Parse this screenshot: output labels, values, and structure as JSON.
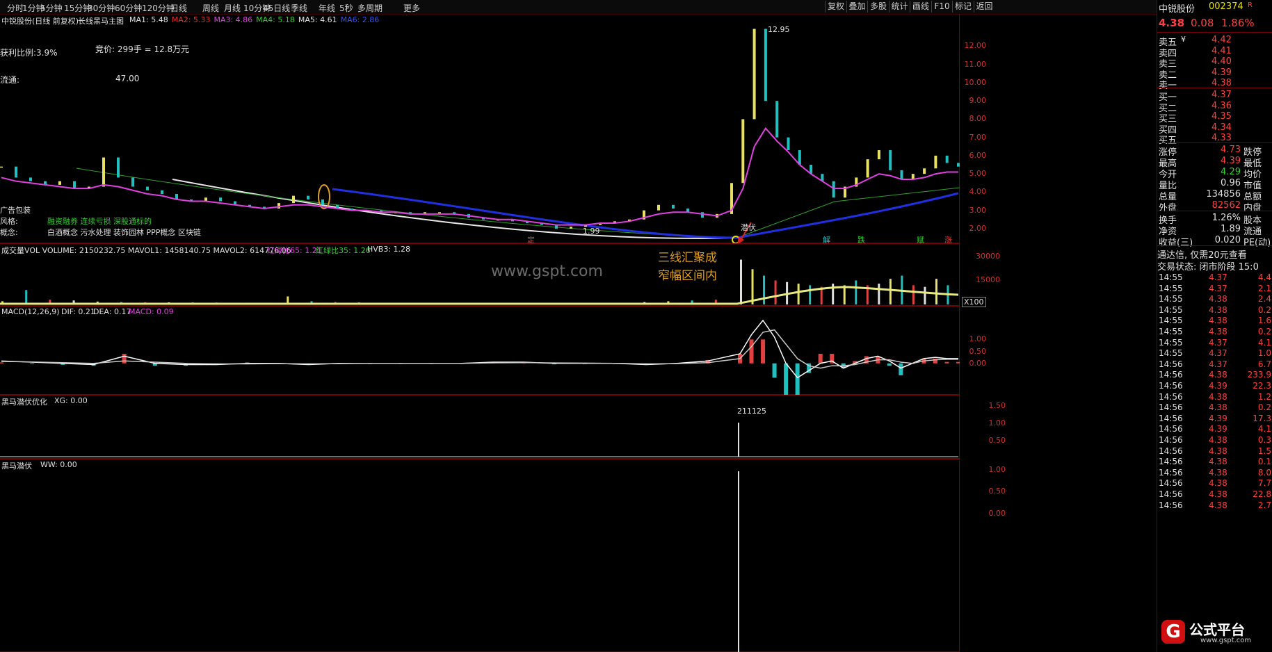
{
  "toolbar": {
    "timeframes": [
      "分时",
      "1分钟",
      "5分钟",
      "15分钟",
      "30分钟",
      "60分钟",
      "120分钟",
      "日线",
      "周线",
      "月线",
      "10分钟",
      "45日线",
      "季线",
      "年线",
      "5秒",
      "多周期",
      "更多"
    ],
    "buttons": [
      "复权",
      "叠加",
      "多股",
      "统计",
      "画线",
      "F10",
      "标记",
      "返回"
    ]
  },
  "main_panel": {
    "title": "中锐股份(日线 前复权)",
    "indicator": "长线黑马主图",
    "ma": [
      {
        "label": "MA1: 5.48",
        "color": "#e0e0e0"
      },
      {
        "label": "MA2: 5.33",
        "color": "#e03030"
      },
      {
        "label": "MA3: 4.86",
        "color": "#e040e0"
      },
      {
        "label": "MA4: 5.18",
        "color": "#30d030"
      },
      {
        "label": "MA5: 4.61",
        "color": "#e0e0e0"
      },
      {
        "label": "MA6: 2.86",
        "color": "#3050ff"
      }
    ],
    "info": {
      "auction": "竞价: 299手 = 12.8万元",
      "profit_ratio": "获利比例:3.9%",
      "float_label": "流通:",
      "float_value": "47.00",
      "ad_pack": "广告包装",
      "style_label": "风格:",
      "style_value": "融资融券 连续亏损 深股通标的",
      "concept_label": "概念:",
      "concept_value": "白酒概念 污水处理 装饰园林 PPP概念 区块链"
    },
    "high_label": "12.95",
    "low_label": "1.99",
    "signal_label": "潜伏",
    "annotation": [
      "三线汇聚成",
      "窄幅区间内"
    ],
    "watermark": "www.gspt.com",
    "markers": [
      "定",
      "解",
      "跌",
      "赋",
      "涨"
    ]
  },
  "volume_panel": {
    "title": "成交量VOL VOLUME: 2150232.75 MAVOL1: 1458140.75 MAVOL2: 614776.06",
    "extra": [
      "红绿比65: 1.21",
      "红绿比35: 1.26",
      "HVB3: 1.28"
    ],
    "unit": "X100"
  },
  "macd_panel": {
    "title": "MACD(12,26,9)",
    "dif": "DIF: 0.21",
    "dea": "DEA: 0.17",
    "macd": "MACD: 0.09"
  },
  "xg_panel": {
    "title": "黑马潜伏优化",
    "value": "XG: 0.00",
    "label": "211125"
  },
  "ww_panel": {
    "title": "黑马潜伏",
    "value": "WW: 0.00"
  },
  "quote": {
    "name": "中锐股份",
    "code": "002374",
    "flag": "R",
    "price": "4.38",
    "change": "0.08",
    "pct": "1.86%",
    "asks": [
      {
        "label": "卖五",
        "price": "4.42"
      },
      {
        "label": "卖四",
        "price": "4.41"
      },
      {
        "label": "卖三",
        "price": "4.40"
      },
      {
        "label": "卖二",
        "price": "4.39"
      },
      {
        "label": "卖一",
        "price": "4.38"
      }
    ],
    "ask_unit": "¥",
    "bids": [
      {
        "label": "买一",
        "price": "4.37"
      },
      {
        "label": "买二",
        "price": "4.36"
      },
      {
        "label": "买三",
        "price": "4.35"
      },
      {
        "label": "买四",
        "price": "4.34"
      },
      {
        "label": "买五",
        "price": "4.33"
      }
    ],
    "stats": [
      {
        "l": "涨停",
        "v": "4.73",
        "r": "跌停",
        "c": "#ff4040"
      },
      {
        "l": "最高",
        "v": "4.39",
        "r": "最低",
        "c": "#ff4040"
      },
      {
        "l": "今开",
        "v": "4.29",
        "r": "均价",
        "c": "#30d030"
      },
      {
        "l": "量比",
        "v": "0.96",
        "r": "市值",
        "c": "#e0e0e0"
      },
      {
        "l": "总量",
        "v": "134856",
        "r": "总额",
        "c": "#e0e0e0"
      },
      {
        "l": "外盘",
        "v": "82562",
        "r": "内盘",
        "c": "#ff4040"
      }
    ],
    "stats2": [
      {
        "l": "换手",
        "v": "1.26%",
        "r": "股本"
      },
      {
        "l": "净资",
        "v": "1.89",
        "r": "流通"
      },
      {
        "l": "收益(三)",
        "v": "0.020",
        "r": "PE(动)"
      }
    ],
    "promo": "通达信, 仅需20元查看",
    "trade_status": "交易状态: 闭市阶段 15:0",
    "ticks": [
      {
        "t": "14:55",
        "p": "4.37",
        "v": "4.4",
        "c": "#ff4040"
      },
      {
        "t": "14:55",
        "p": "4.37",
        "v": "2.1",
        "c": "#ff4040"
      },
      {
        "t": "14:55",
        "p": "4.38",
        "v": "2.4",
        "c": "#ff4040"
      },
      {
        "t": "14:55",
        "p": "4.38",
        "v": "0.2",
        "c": "#ff4040"
      },
      {
        "t": "14:55",
        "p": "4.38",
        "v": "1.6",
        "c": "#ff4040"
      },
      {
        "t": "14:55",
        "p": "4.38",
        "v": "0.2",
        "c": "#ff4040"
      },
      {
        "t": "14:55",
        "p": "4.37",
        "v": "4.1",
        "c": "#ff4040"
      },
      {
        "t": "14:55",
        "p": "4.37",
        "v": "1.0",
        "c": "#ff4040"
      },
      {
        "t": "14:56",
        "p": "4.37",
        "v": "6.7",
        "c": "#ff4040"
      },
      {
        "t": "14:56",
        "p": "4.38",
        "v": "233.9",
        "c": "#ff4040"
      },
      {
        "t": "14:56",
        "p": "4.39",
        "v": "22.3",
        "c": "#ff4040"
      },
      {
        "t": "14:56",
        "p": "4.38",
        "v": "1.2",
        "c": "#ff4040"
      },
      {
        "t": "14:56",
        "p": "4.38",
        "v": "0.2",
        "c": "#ff4040"
      },
      {
        "t": "14:56",
        "p": "4.39",
        "v": "17.3",
        "c": "#ff4040"
      },
      {
        "t": "14:56",
        "p": "4.39",
        "v": "4.1",
        "c": "#ff4040"
      },
      {
        "t": "14:56",
        "p": "4.38",
        "v": "0.3",
        "c": "#ff4040"
      },
      {
        "t": "14:56",
        "p": "4.38",
        "v": "1.5",
        "c": "#ff4040"
      },
      {
        "t": "14:56",
        "p": "4.38",
        "v": "0.1",
        "c": "#ff4040"
      },
      {
        "t": "14:56",
        "p": "4.38",
        "v": "8.0",
        "c": "#ff4040"
      },
      {
        "t": "14:56",
        "p": "4.38",
        "v": "7.7",
        "c": "#ff4040"
      },
      {
        "t": "14:56",
        "p": "4.38",
        "v": "22.8",
        "c": "#ff4040"
      },
      {
        "t": "14:56",
        "p": "4.38",
        "v": "2.7",
        "c": "#ff4040"
      }
    ],
    "logo_text": "公式平台",
    "logo_url": "www.gspt.com"
  },
  "chart_data": [
    {
      "type": "line",
      "title": "长线黑马主图",
      "ylim": [
        1.5,
        13.2
      ],
      "yticks": [
        "12.00",
        "11.00",
        "10.00",
        "9.00",
        "8.00",
        "7.00",
        "6.00",
        "5.00",
        "4.00",
        "3.00",
        "2.00"
      ],
      "series": [
        {
          "name": "价格",
          "color": "#c8c8c8",
          "values": [
            5.4,
            4.8,
            4.6,
            4.4,
            4.6,
            4.2,
            4.3,
            5.9,
            4.8,
            4.3,
            4.1,
            3.9,
            3.6,
            3.5,
            3.7,
            3.5,
            3.3,
            3.2,
            3.1,
            3.4,
            3.8,
            3.6,
            3.3,
            3.1,
            3.0,
            3.0,
            2.9,
            2.9,
            2.8,
            2.9,
            2.9,
            2.8,
            2.6,
            2.5,
            2.5,
            2.4,
            2.3,
            2.2,
            2.0,
            2.1,
            2.2,
            2.3,
            2.4,
            2.5,
            3.0,
            3.3,
            3.1,
            2.9,
            2.6,
            2.8,
            4.5,
            8.0,
            12.95,
            9.0,
            7.0,
            6.3,
            5.5,
            5.0,
            4.6,
            3.7,
            4.3,
            4.8,
            5.8,
            6.3,
            5.2,
            4.7,
            5.0,
            5.3,
            6.0,
            5.6,
            5.4
          ]
        },
        {
          "name": "MA3",
          "color": "#e040e0",
          "values": [
            4.8,
            4.6,
            4.5,
            4.4,
            4.3,
            4.2,
            4.2,
            4.4,
            4.3,
            4.1,
            3.9,
            3.8,
            3.6,
            3.5,
            3.5,
            3.4,
            3.3,
            3.2,
            3.1,
            3.2,
            3.3,
            3.3,
            3.2,
            3.1,
            3.0,
            3.0,
            2.9,
            2.9,
            2.8,
            2.8,
            2.8,
            2.8,
            2.7,
            2.6,
            2.5,
            2.5,
            2.4,
            2.3,
            2.2,
            2.2,
            2.2,
            2.3,
            2.3,
            2.4,
            2.6,
            2.8,
            2.9,
            2.9,
            2.8,
            2.7,
            3.0,
            4.2,
            6.5,
            7.5,
            6.8,
            6.2,
            5.5,
            5.0,
            4.6,
            4.2,
            4.2,
            4.4,
            4.7,
            5.0,
            4.9,
            4.7,
            4.7,
            4.8,
            5.0,
            5.1,
            5.1
          ]
        }
      ]
    },
    {
      "type": "bar",
      "title": "成交量VOL",
      "ylim": [
        0,
        33000
      ],
      "yticks": [
        "30000",
        "15000"
      ],
      "values": [
        2000,
        9000,
        3000,
        2500,
        1800,
        1500,
        1400,
        1300,
        1200,
        1200,
        1100,
        1000,
        5000,
        2000,
        1500,
        1200,
        1000,
        900,
        800,
        700,
        600,
        600,
        600,
        600,
        700,
        800,
        900,
        1500,
        2000,
        2500,
        3000,
        28000,
        22000,
        18000,
        15000,
        14000,
        13000,
        12000,
        11000,
        13000,
        12000,
        15000,
        12000,
        13000,
        16000,
        18000,
        12000,
        11000,
        16000,
        12000
      ]
    },
    {
      "type": "line",
      "title": "MACD(12,26,9)",
      "ylim": [
        -1.2,
        2.0
      ],
      "yticks": [
        "1.00",
        "0.50",
        "0.00"
      ],
      "series": [
        {
          "name": "DIF",
          "color": "#e0e0e0",
          "values": [
            0.1,
            0.05,
            0.0,
            -0.05,
            0.3,
            0.0,
            -0.05,
            -0.05,
            0.0,
            0.0,
            -0.05,
            0.0,
            0.0,
            0.0,
            0.0,
            0.0,
            0.05,
            0.05,
            0.0,
            0.0,
            0.0,
            -0.05,
            0.0,
            0.1,
            0.4,
            1.2,
            1.8,
            1.1,
            0.0,
            -0.6,
            -0.3,
            0.0,
            0.1,
            -0.2,
            0.0,
            0.2,
            0.3,
            0.1,
            -0.2,
            0.0,
            0.2,
            0.25,
            0.2,
            0.2
          ]
        },
        {
          "name": "DEA",
          "color": "#e0e0e0",
          "values": [
            0.08,
            0.06,
            0.03,
            0.0,
            0.1,
            0.05,
            0.0,
            -0.02,
            -0.02,
            -0.01,
            -0.02,
            -0.01,
            0.0,
            0.0,
            0.0,
            0.0,
            0.02,
            0.03,
            0.02,
            0.01,
            0.0,
            -0.02,
            -0.01,
            0.03,
            0.2,
            0.7,
            1.3,
            1.4,
            0.8,
            0.2,
            -0.1,
            -0.2,
            -0.1,
            -0.1,
            -0.05,
            0.05,
            0.15,
            0.15,
            0.05,
            0.0,
            0.1,
            0.15,
            0.17,
            0.17
          ]
        }
      ]
    }
  ]
}
